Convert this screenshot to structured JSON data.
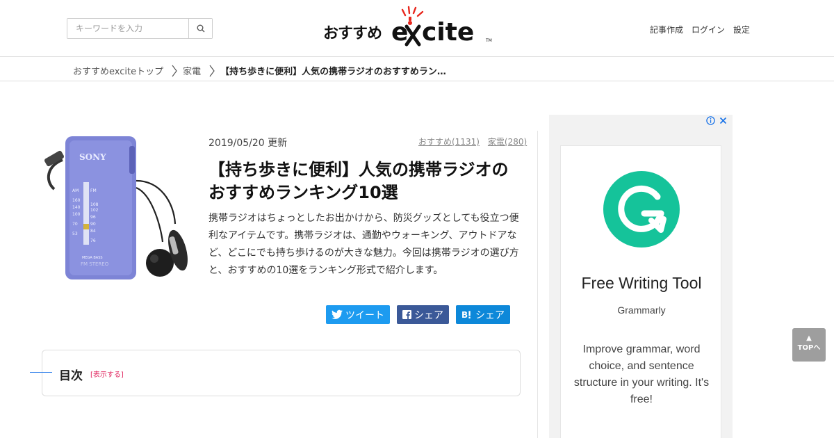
{
  "header": {
    "search_placeholder": "キーワードを入力",
    "logo_text": "おすすめ",
    "logo_brand": "excite",
    "nav": [
      "記事作成",
      "ログイン",
      "設定"
    ]
  },
  "breadcrumb": {
    "items": [
      "おすすめexciteトップ",
      "家電"
    ],
    "current": "【持ち歩きに便利】人気の携帯ラジオのおすすめラン…"
  },
  "article": {
    "date": "2019/05/20 更新",
    "tags": [
      "おすすめ(1131)",
      "家電(280)"
    ],
    "title": "【持ち歩きに便利】人気の携帯ラジオのおすすめランキング10選",
    "description": "携帯ラジオはちょっとしたお出かけから、防災グッズとしても役立つ便利なアイテムです。携帯ラジオは、通勤やウォーキング、アウトドアなど、どこにでも持ち歩けるのが大きな魅力。今回は携帯ラジオの選び方と、おすすめの10選をランキング形式で紹介します。",
    "image_brand": "SONY",
    "share": {
      "tweet": "ツイート",
      "facebook": "シェア",
      "hatena": "シェア"
    },
    "toc": {
      "title": "目次",
      "toggle": "[表示する]"
    }
  },
  "ad": {
    "title": "Free Writing Tool",
    "brand": "Grammarly",
    "body": "Improve grammar, word choice, and sentence structure in your writing. It's free!"
  },
  "top_button": {
    "arrow": "▲",
    "label": "TOPへ"
  },
  "colors": {
    "twitter": "#1d9bf0",
    "facebook": "#3b5998",
    "hatena": "#0d88d9",
    "grammarly": "#15c39a",
    "toc_accent": "#e0245e",
    "logo_accent": "#e8261c"
  }
}
